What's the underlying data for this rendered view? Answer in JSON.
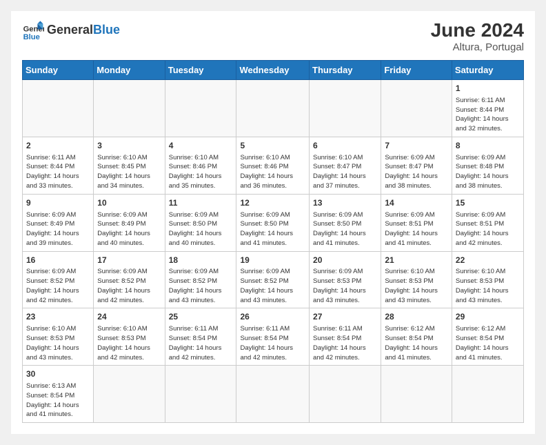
{
  "header": {
    "logo_general": "General",
    "logo_blue": "Blue",
    "month_year": "June 2024",
    "location": "Altura, Portugal"
  },
  "weekdays": [
    "Sunday",
    "Monday",
    "Tuesday",
    "Wednesday",
    "Thursday",
    "Friday",
    "Saturday"
  ],
  "weeks": [
    [
      {
        "day": "",
        "info": ""
      },
      {
        "day": "",
        "info": ""
      },
      {
        "day": "",
        "info": ""
      },
      {
        "day": "",
        "info": ""
      },
      {
        "day": "",
        "info": ""
      },
      {
        "day": "",
        "info": ""
      },
      {
        "day": "1",
        "info": "Sunrise: 6:11 AM\nSunset: 8:44 PM\nDaylight: 14 hours\nand 32 minutes."
      }
    ],
    [
      {
        "day": "2",
        "info": "Sunrise: 6:11 AM\nSunset: 8:44 PM\nDaylight: 14 hours\nand 33 minutes."
      },
      {
        "day": "3",
        "info": "Sunrise: 6:10 AM\nSunset: 8:45 PM\nDaylight: 14 hours\nand 34 minutes."
      },
      {
        "day": "4",
        "info": "Sunrise: 6:10 AM\nSunset: 8:46 PM\nDaylight: 14 hours\nand 35 minutes."
      },
      {
        "day": "5",
        "info": "Sunrise: 6:10 AM\nSunset: 8:46 PM\nDaylight: 14 hours\nand 36 minutes."
      },
      {
        "day": "6",
        "info": "Sunrise: 6:10 AM\nSunset: 8:47 PM\nDaylight: 14 hours\nand 37 minutes."
      },
      {
        "day": "7",
        "info": "Sunrise: 6:09 AM\nSunset: 8:47 PM\nDaylight: 14 hours\nand 38 minutes."
      },
      {
        "day": "8",
        "info": "Sunrise: 6:09 AM\nSunset: 8:48 PM\nDaylight: 14 hours\nand 38 minutes."
      }
    ],
    [
      {
        "day": "9",
        "info": "Sunrise: 6:09 AM\nSunset: 8:49 PM\nDaylight: 14 hours\nand 39 minutes."
      },
      {
        "day": "10",
        "info": "Sunrise: 6:09 AM\nSunset: 8:49 PM\nDaylight: 14 hours\nand 40 minutes."
      },
      {
        "day": "11",
        "info": "Sunrise: 6:09 AM\nSunset: 8:50 PM\nDaylight: 14 hours\nand 40 minutes."
      },
      {
        "day": "12",
        "info": "Sunrise: 6:09 AM\nSunset: 8:50 PM\nDaylight: 14 hours\nand 41 minutes."
      },
      {
        "day": "13",
        "info": "Sunrise: 6:09 AM\nSunset: 8:50 PM\nDaylight: 14 hours\nand 41 minutes."
      },
      {
        "day": "14",
        "info": "Sunrise: 6:09 AM\nSunset: 8:51 PM\nDaylight: 14 hours\nand 41 minutes."
      },
      {
        "day": "15",
        "info": "Sunrise: 6:09 AM\nSunset: 8:51 PM\nDaylight: 14 hours\nand 42 minutes."
      }
    ],
    [
      {
        "day": "16",
        "info": "Sunrise: 6:09 AM\nSunset: 8:52 PM\nDaylight: 14 hours\nand 42 minutes."
      },
      {
        "day": "17",
        "info": "Sunrise: 6:09 AM\nSunset: 8:52 PM\nDaylight: 14 hours\nand 42 minutes."
      },
      {
        "day": "18",
        "info": "Sunrise: 6:09 AM\nSunset: 8:52 PM\nDaylight: 14 hours\nand 43 minutes."
      },
      {
        "day": "19",
        "info": "Sunrise: 6:09 AM\nSunset: 8:52 PM\nDaylight: 14 hours\nand 43 minutes."
      },
      {
        "day": "20",
        "info": "Sunrise: 6:09 AM\nSunset: 8:53 PM\nDaylight: 14 hours\nand 43 minutes."
      },
      {
        "day": "21",
        "info": "Sunrise: 6:10 AM\nSunset: 8:53 PM\nDaylight: 14 hours\nand 43 minutes."
      },
      {
        "day": "22",
        "info": "Sunrise: 6:10 AM\nSunset: 8:53 PM\nDaylight: 14 hours\nand 43 minutes."
      }
    ],
    [
      {
        "day": "23",
        "info": "Sunrise: 6:10 AM\nSunset: 8:53 PM\nDaylight: 14 hours\nand 43 minutes."
      },
      {
        "day": "24",
        "info": "Sunrise: 6:10 AM\nSunset: 8:53 PM\nDaylight: 14 hours\nand 42 minutes."
      },
      {
        "day": "25",
        "info": "Sunrise: 6:11 AM\nSunset: 8:54 PM\nDaylight: 14 hours\nand 42 minutes."
      },
      {
        "day": "26",
        "info": "Sunrise: 6:11 AM\nSunset: 8:54 PM\nDaylight: 14 hours\nand 42 minutes."
      },
      {
        "day": "27",
        "info": "Sunrise: 6:11 AM\nSunset: 8:54 PM\nDaylight: 14 hours\nand 42 minutes."
      },
      {
        "day": "28",
        "info": "Sunrise: 6:12 AM\nSunset: 8:54 PM\nDaylight: 14 hours\nand 41 minutes."
      },
      {
        "day": "29",
        "info": "Sunrise: 6:12 AM\nSunset: 8:54 PM\nDaylight: 14 hours\nand 41 minutes."
      }
    ],
    [
      {
        "day": "30",
        "info": "Sunrise: 6:13 AM\nSunset: 8:54 PM\nDaylight: 14 hours\nand 41 minutes."
      },
      {
        "day": "",
        "info": ""
      },
      {
        "day": "",
        "info": ""
      },
      {
        "day": "",
        "info": ""
      },
      {
        "day": "",
        "info": ""
      },
      {
        "day": "",
        "info": ""
      },
      {
        "day": "",
        "info": ""
      }
    ]
  ]
}
